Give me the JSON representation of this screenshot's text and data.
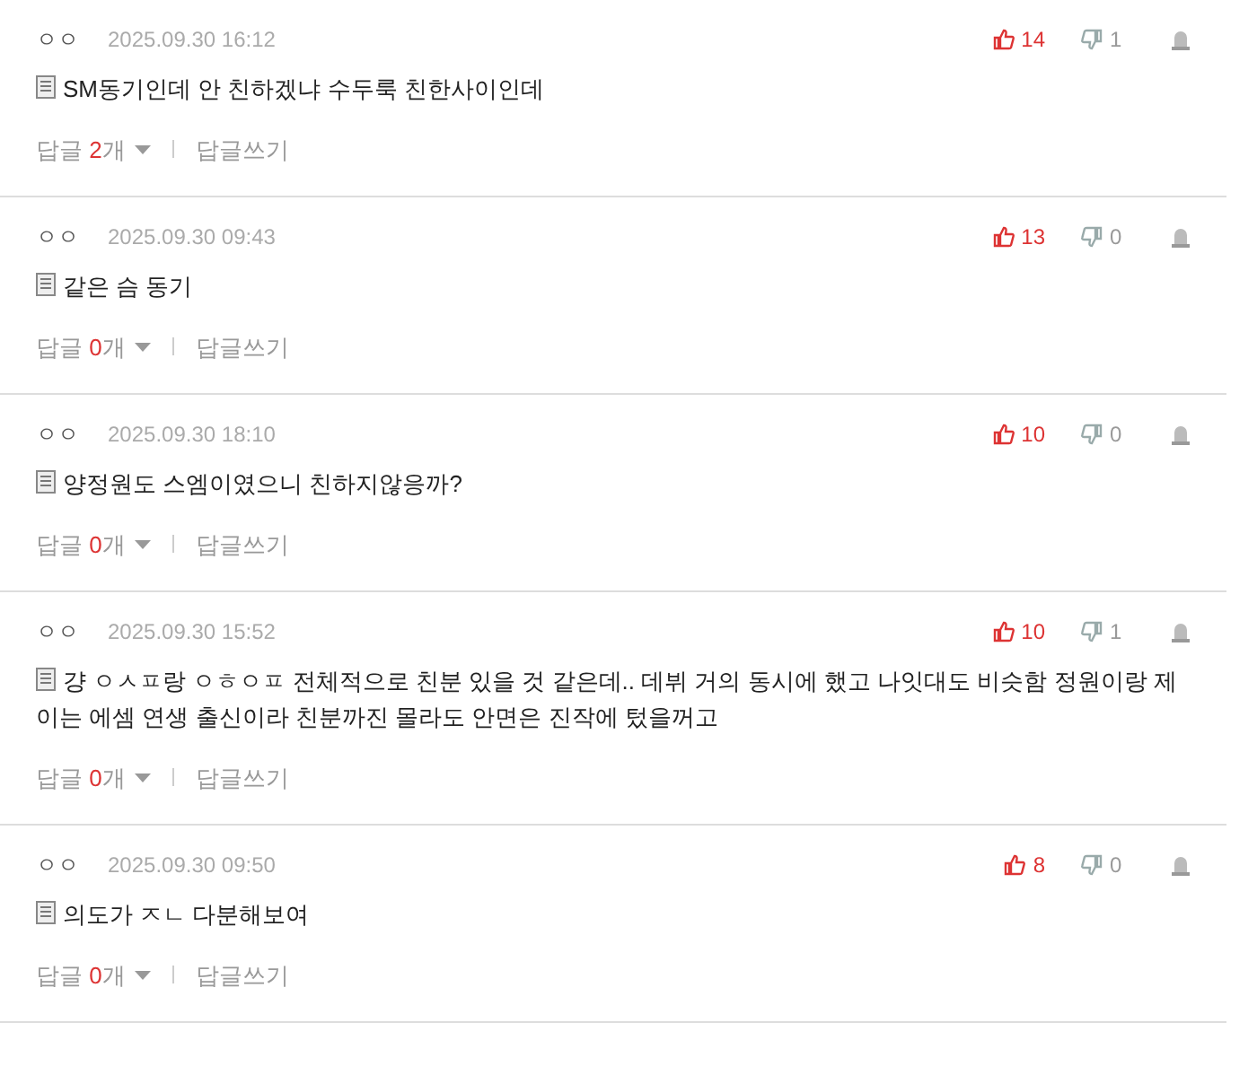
{
  "comments": [
    {
      "author": "ㅇㅇ",
      "date": "2025.09.30 16:12",
      "upvotes": "14",
      "downvotes": "1",
      "text": "SM동기인데 안 친하겠냐 수두룩 친한사이인데",
      "reply_label": "답글",
      "reply_count": "2",
      "reply_unit": "개",
      "write_reply": "답글쓰기"
    },
    {
      "author": "ㅇㅇ",
      "date": "2025.09.30 09:43",
      "upvotes": "13",
      "downvotes": "0",
      "text": "같은 슴 동기",
      "reply_label": "답글",
      "reply_count": "0",
      "reply_unit": "개",
      "write_reply": "답글쓰기"
    },
    {
      "author": "ㅇㅇ",
      "date": "2025.09.30 18:10",
      "upvotes": "10",
      "downvotes": "0",
      "text": "양정원도 스엠이였으니 친하지않응까?",
      "reply_label": "답글",
      "reply_count": "0",
      "reply_unit": "개",
      "write_reply": "답글쓰기"
    },
    {
      "author": "ㅇㅇ",
      "date": "2025.09.30 15:52",
      "upvotes": "10",
      "downvotes": "1",
      "text": "걍 ㅇㅅㅍ랑 ㅇㅎㅇㅍ 전체적으로 친분 있을 것 같은데.. 데뷔 거의 동시에 했고 나잇대도 비슷함 정원이랑 제이는 에셈 연생 출신이라 친분까진 몰라도 안면은 진작에 텄을꺼고",
      "reply_label": "답글",
      "reply_count": "0",
      "reply_unit": "개",
      "write_reply": "답글쓰기"
    },
    {
      "author": "ㅇㅇ",
      "date": "2025.09.30 09:50",
      "upvotes": "8",
      "downvotes": "0",
      "text": "의도가 ㅈㄴ 다분해보여",
      "reply_label": "답글",
      "reply_count": "0",
      "reply_unit": "개",
      "write_reply": "답글쓰기"
    }
  ]
}
